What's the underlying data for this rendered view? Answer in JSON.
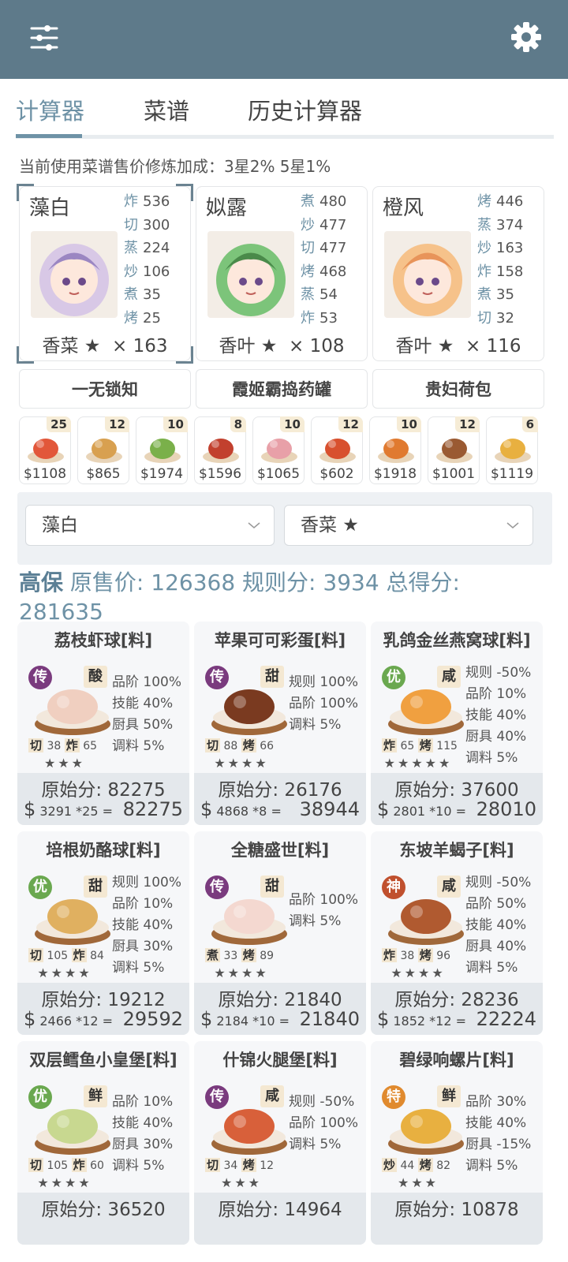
{
  "tabs": [
    {
      "label": "计算器",
      "active": true
    },
    {
      "label": "菜谱",
      "active": false
    },
    {
      "label": "历史计算器",
      "active": false
    }
  ],
  "info_text": "当前使用菜谱售价修炼加成：3星2% 5星1%",
  "chefs": [
    {
      "name": "藻白",
      "skills": [
        [
          "炸",
          "536"
        ],
        [
          "切",
          "300"
        ],
        [
          "蒸",
          "224"
        ],
        [
          "炒",
          "106"
        ],
        [
          "煮",
          "35"
        ],
        [
          "烤",
          "25"
        ]
      ],
      "ingredient": "香菜",
      "star": "★",
      "count": "× 163",
      "avatar": "chef-zaobai-avatar"
    },
    {
      "name": "姒露",
      "skills": [
        [
          "煮",
          "480"
        ],
        [
          "炒",
          "477"
        ],
        [
          "切",
          "477"
        ],
        [
          "烤",
          "468"
        ],
        [
          "蒸",
          "54"
        ],
        [
          "炸",
          "53"
        ]
      ],
      "ingredient": "香叶",
      "star": "★",
      "count": "× 108",
      "avatar": "chef-silu-avatar"
    },
    {
      "name": "橙风",
      "skills": [
        [
          "烤",
          "446"
        ],
        [
          "蒸",
          "374"
        ],
        [
          "炒",
          "163"
        ],
        [
          "炸",
          "158"
        ],
        [
          "煮",
          "35"
        ],
        [
          "切",
          "32"
        ]
      ],
      "ingredient": "香叶",
      "star": "★",
      "count": "× 116",
      "avatar": "chef-chengfeng-avatar"
    }
  ],
  "tools": [
    "一无锁知",
    "霞姬霸捣药罐",
    "贵妇荷包"
  ],
  "dishes": [
    {
      "qty": "25",
      "price": "$1108"
    },
    {
      "qty": "12",
      "price": "$865"
    },
    {
      "qty": "10",
      "price": "$1974"
    },
    {
      "qty": "8",
      "price": "$1596"
    },
    {
      "qty": "10",
      "price": "$1065"
    },
    {
      "qty": "12",
      "price": "$602"
    },
    {
      "qty": "10",
      "price": "$1918"
    },
    {
      "qty": "12",
      "price": "$1001"
    },
    {
      "qty": "6",
      "price": "$1119"
    }
  ],
  "selects": {
    "chef": "藻白",
    "ingredient": "香菜 ★"
  },
  "summary": {
    "lead": "高保",
    "text": "原售价:  126368 规则分:  3934 总得分:  281635"
  },
  "recipes": [
    {
      "title": "荔枝虾球[料]",
      "rarity": "传",
      "rarity_color": "#7a3b7e",
      "flavor": "酸",
      "stats": [
        "品阶 100%",
        "技能 40%",
        "厨具 50%",
        "调料 5%"
      ],
      "sk1": "切",
      "v1": "38",
      "sk2": "炸",
      "v2": "65",
      "stars": "★★★",
      "orig": "原始分: 82275",
      "unit": "3291 *25",
      "total": "82275"
    },
    {
      "title": "苹果可可彩蛋[料]",
      "rarity": "传",
      "rarity_color": "#7a3b7e",
      "flavor": "甜",
      "stats": [
        "规则 100%",
        "品阶 100%",
        "调料 5%"
      ],
      "sk1": "切",
      "v1": "88",
      "sk2": "烤",
      "v2": "66",
      "stars": "★★★★",
      "orig": "原始分: 26176",
      "unit": "4868 *8",
      "total": "38944"
    },
    {
      "title": "乳鸽金丝燕窝球[料]",
      "rarity": "优",
      "rarity_color": "#6aa84f",
      "flavor": "咸",
      "stats": [
        "规则 -50%",
        "品阶 10%",
        "技能 40%",
        "厨具 40%",
        "调料 5%"
      ],
      "sk1": "炸",
      "v1": "65",
      "sk2": "烤",
      "v2": "115",
      "stars": "★★★★★",
      "orig": "原始分: 37600",
      "unit": "2801 *10",
      "total": "28010"
    },
    {
      "title": "培根奶酪球[料]",
      "rarity": "优",
      "rarity_color": "#6aa84f",
      "flavor": "甜",
      "stats": [
        "规则 100%",
        "品阶 10%",
        "技能 40%",
        "厨具 30%",
        "调料 5%"
      ],
      "sk1": "切",
      "v1": "105",
      "sk2": "炸",
      "v2": "84",
      "stars": "★★★★",
      "orig": "原始分: 19212",
      "unit": "2466 *12",
      "total": "29592"
    },
    {
      "title": "全糖盛世[料]",
      "rarity": "传",
      "rarity_color": "#7a3b7e",
      "flavor": "甜",
      "stats": [
        "品阶 100%",
        "调料 5%"
      ],
      "sk1": "煮",
      "v1": "33",
      "sk2": "烤",
      "v2": "89",
      "stars": "★★★★",
      "orig": "原始分: 21840",
      "unit": "2184 *10",
      "total": "21840"
    },
    {
      "title": "东坡羊蝎子[料]",
      "rarity": "神",
      "rarity_color": "#c0502e",
      "flavor": "咸",
      "stats": [
        "规则 -50%",
        "品阶 50%",
        "技能 40%",
        "厨具 40%",
        "调料 5%"
      ],
      "sk1": "炸",
      "v1": "38",
      "sk2": "烤",
      "v2": "96",
      "stars": "★★★★",
      "orig": "原始分: 28236",
      "unit": "1852 *12",
      "total": "22224"
    },
    {
      "title": "双层鳕鱼小皇堡[料]",
      "rarity": "优",
      "rarity_color": "#6aa84f",
      "flavor": "鲜",
      "stats": [
        "品阶 10%",
        "技能 40%",
        "厨具 30%",
        "调料 5%"
      ],
      "sk1": "切",
      "v1": "105",
      "sk2": "炸",
      "v2": "60",
      "stars": "★★★★",
      "orig": "原始分: 36520",
      "unit": "",
      "total": ""
    },
    {
      "title": "什锦火腿堡[料]",
      "rarity": "传",
      "rarity_color": "#7a3b7e",
      "flavor": "咸",
      "stats": [
        "规则 -50%",
        "品阶 100%",
        "调料 5%"
      ],
      "sk1": "切",
      "v1": "34",
      "sk2": "烤",
      "v2": "12",
      "stars": "★★★",
      "orig": "原始分: 14964",
      "unit": "",
      "total": ""
    },
    {
      "title": "碧绿响螺片[料]",
      "rarity": "特",
      "rarity_color": "#e08a2e",
      "flavor": "鲜",
      "stats": [
        "品阶 30%",
        "技能 40%",
        "厨具 -15%",
        "调料 5%"
      ],
      "sk1": "炒",
      "v1": "44",
      "sk2": "烤",
      "v2": "82",
      "stars": "★★★",
      "orig": "原始分: 10878",
      "unit": "",
      "total": ""
    }
  ]
}
